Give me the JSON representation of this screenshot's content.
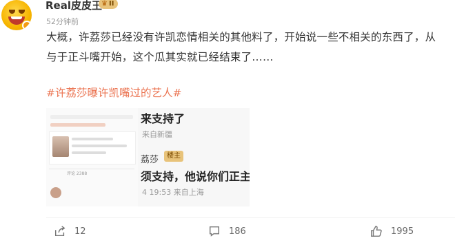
{
  "post": {
    "username": "Real皮皮王",
    "badge": "II",
    "timestamp": "52分钟前",
    "body": "大概，许荔莎已经没有许凯恋情相关的其他料了，开始说一些不相关的东西了，从与于正斗嘴开始，这个瓜其实就已经结束了……",
    "hashtag": "#许荔莎曝许凯嘴过的艺人#"
  },
  "image": {
    "count_label": "评论 2388",
    "chat_line1": "来支持了",
    "chat_sub1": "来自新疆",
    "chat_name": "荔莎",
    "chat_badge": "楼主",
    "chat_line2": "须支持，他说你们正主",
    "chat_sub2": "4 19:53 来自上海"
  },
  "actions": {
    "share_count": "12",
    "comment_count": "186",
    "like_count": "1995"
  },
  "icons": {
    "share": "share-icon",
    "comment": "comment-icon",
    "like": "thumbs-up-icon",
    "crown": "crown-icon"
  },
  "colors": {
    "hashtag": "#eb7350",
    "badge_bg": "#e8c37a"
  }
}
